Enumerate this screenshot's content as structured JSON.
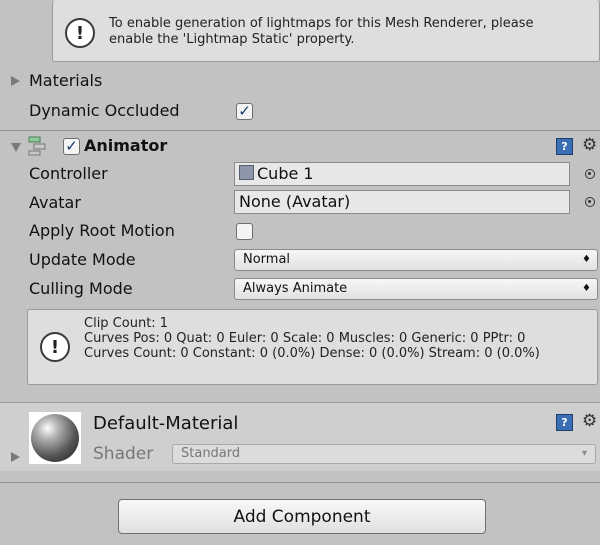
{
  "mesh_renderer": {
    "lightmap_help_line1": "To enable generation of lightmaps for this Mesh Renderer, please",
    "lightmap_help_line2": "enable the 'Lightmap Static' property.",
    "materials_label": "Materials",
    "dynamic_occluded_label": "Dynamic Occluded",
    "dynamic_occluded_checked": true
  },
  "animator": {
    "title": "Animator",
    "enabled": true,
    "controller_label": "Controller",
    "controller_value": "Cube 1",
    "avatar_label": "Avatar",
    "avatar_value": "None (Avatar)",
    "apply_root_motion_label": "Apply Root Motion",
    "apply_root_motion_checked": false,
    "update_mode_label": "Update Mode",
    "update_mode_value": "Normal",
    "culling_mode_label": "Culling Mode",
    "culling_mode_value": "Always Animate",
    "info_line1": "Clip Count: 1",
    "info_line2": "Curves Pos: 0 Quat: 0 Euler: 0 Scale: 0 Muscles: 0 Generic: 0 PPtr: 0",
    "info_line3": "Curves Count: 0 Constant: 0 (0.0%) Dense: 0 (0.0%) Stream: 0 (0.0%)"
  },
  "material": {
    "name": "Default-Material",
    "shader_label": "Shader",
    "shader_value": "Standard"
  },
  "footer": {
    "add_component_label": "Add Component"
  },
  "icons": {
    "help": "help-book-icon",
    "settings": "gear-icon",
    "warning": "warning-icon",
    "object_picker": "object-picker-icon"
  }
}
